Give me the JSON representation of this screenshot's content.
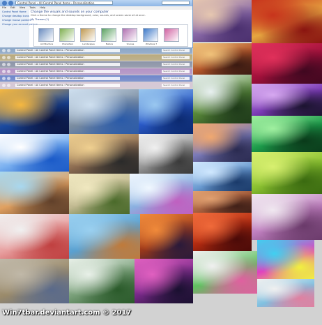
{
  "window": {
    "address": "Control Panel  ›  All Control Panel Items  ›  Personalization",
    "menu": [
      "File",
      "Edit",
      "View",
      "Tools",
      "Help"
    ],
    "left_pane": [
      "Control Panel Home",
      "Change desktop icons",
      "Change mouse pointers",
      "Change your account picture"
    ],
    "heading": "Change the visuals and sounds on your computer",
    "subtext": "Click a theme to change the desktop background, color, sounds, and screen saver all at once.",
    "section_label": "My Themes (1)",
    "themes": [
      {
        "label": "Architecture",
        "color": "#6a8cc0"
      },
      {
        "label": "Characters",
        "color": "#7fb050"
      },
      {
        "label": "Landscapes",
        "color": "#c09850"
      },
      {
        "label": "Nature",
        "color": "#5aa060"
      },
      {
        "label": "Scenes",
        "color": "#b070b0"
      },
      {
        "label": "Windows 7",
        "color": "#3c78c8"
      },
      {
        "label": "",
        "color": "#d060a0"
      }
    ]
  },
  "title_bars": [
    {
      "address": "Control Panel  ›  All Control Panel Items  ›  Personalization",
      "search": "Search Control Panel",
      "color": "#8aa6c8"
    },
    {
      "address": "Control Panel  ›  All Control Panel Items  ›  Personalization",
      "search": "Search Control Panel",
      "color": "#b9aa7d"
    },
    {
      "address": "Control Panel  ›  All Control Panel Items  ›  Personalization",
      "search": "Search Control Panel",
      "color": "#8c94a8"
    },
    {
      "address": "Control Panel  ›  All Control Panel Items  ›  Personalization",
      "search": "Search Control Panel",
      "color": "#b492c6"
    },
    {
      "address": "Control Panel  ›  All Control Panel Items  ›  Personalization",
      "search": "Search Control Panel",
      "color": "#6e86cc"
    },
    {
      "address": "Control Panel  ›  All Control Panel Items  ›  Personalization",
      "search": "Search Control Panel",
      "color": "#d7c8d6"
    }
  ],
  "wallpapers": [
    {
      "name": "lavender-field-image",
      "colors": [
        "#e6c7b0",
        "#8a6aa8",
        "#4a2f6e"
      ]
    },
    {
      "name": "autumn-leaves-image",
      "colors": [
        "#c8341c",
        "#e6a640",
        "#8a1410"
      ]
    },
    {
      "name": "red-rock-arch-image",
      "colors": [
        "#f0c27a",
        "#b2552a",
        "#3a1a12"
      ]
    },
    {
      "name": "red-dahlia-image",
      "colors": [
        "#e0305a",
        "#a0103a",
        "#400820"
      ]
    },
    {
      "name": "waterfall-image",
      "colors": [
        "#e8f0f0",
        "#5a8a3a",
        "#1e3a1a"
      ]
    },
    {
      "name": "purple-thistle-image",
      "colors": [
        "#d6a8f0",
        "#7a3ab4",
        "#1c1430"
      ]
    },
    {
      "name": "bridge-arches-image",
      "colors": [
        "#f6b840",
        "#1a4aa0",
        "#0a1440"
      ]
    },
    {
      "name": "perforated-dome-image",
      "colors": [
        "#cfe0f0",
        "#7a8ca0",
        "#2a5aa8"
      ]
    },
    {
      "name": "blue-curved-building-image",
      "colors": [
        "#9ac8f0",
        "#2a5ac8",
        "#0c2a70"
      ]
    },
    {
      "name": "coastal-rocks-image",
      "colors": [
        "#f0a870",
        "#7a7ab8",
        "#2a2a50"
      ]
    },
    {
      "name": "green-leaves-image",
      "colors": [
        "#a0f0a0",
        "#1c9a4a",
        "#0a3a1a"
      ]
    },
    {
      "name": "white-museum-image",
      "colors": [
        "#ffffff",
        "#7ab0f0",
        "#1a5ac8"
      ]
    },
    {
      "name": "curved-metal-image",
      "colors": [
        "#f0d090",
        "#8a6a50",
        "#2a2a2a"
      ]
    },
    {
      "name": "white-figures-image",
      "colors": [
        "#f0f0f0",
        "#9a9a9a",
        "#3a3a3a"
      ]
    },
    {
      "name": "mountain-lake-image",
      "colors": [
        "#d0e8ff",
        "#6a9ad0",
        "#1a3a6a"
      ]
    },
    {
      "name": "green-succulent-image",
      "colors": [
        "#d8f070",
        "#8ac030",
        "#3a6a10"
      ]
    },
    {
      "name": "fish-town-illustration",
      "colors": [
        "#a8d8f0",
        "#e0a060",
        "#60402a"
      ]
    },
    {
      "name": "beetles-illustration",
      "colors": [
        "#f0e8c0",
        "#c0b890",
        "#4a6a2a"
      ]
    },
    {
      "name": "creature-illustration",
      "colors": [
        "#f0f8ff",
        "#8ab0e0",
        "#c060c0"
      ]
    },
    {
      "name": "sand-dunes-image",
      "colors": [
        "#e0a070",
        "#a05a3a",
        "#402018"
      ]
    },
    {
      "name": "spiky-flower-image",
      "colors": [
        "#f0e8f0",
        "#c080c0",
        "#6a3a6a"
      ]
    },
    {
      "name": "carnival-illustration",
      "colors": [
        "#f0f0f0",
        "#e8a0a0",
        "#c04040"
      ]
    },
    {
      "name": "floating-island-illustration",
      "colors": [
        "#9ad0f0",
        "#5aa0d0",
        "#c07a3a"
      ]
    },
    {
      "name": "space-needle-image",
      "colors": [
        "#f08a3a",
        "#a03a1a",
        "#2a1a3a"
      ]
    },
    {
      "name": "red-canyon-image",
      "colors": [
        "#f06a3a",
        "#b02a10",
        "#4a0a08"
      ]
    },
    {
      "name": "abstract-colors-illustration",
      "colors": [
        "#c0b8a8",
        "#9a8a6a",
        "#5a6a8a"
      ]
    },
    {
      "name": "green-garden-illustration",
      "colors": [
        "#e8f0e8",
        "#7aa07a",
        "#2a5a2a"
      ]
    },
    {
      "name": "bubbles-illustration",
      "colors": [
        "#e060c0",
        "#7a2a8a",
        "#1a1030"
      ]
    },
    {
      "name": "rainbow-ribbons-illustration",
      "colors": [
        "#f0f0f0",
        "#60c060",
        "#e060a0"
      ]
    },
    {
      "name": "colorful-splash-illustration",
      "colors": [
        "#40d0f0",
        "#e040c0",
        "#f0f040"
      ]
    },
    {
      "name": "sketch-scene-illustration",
      "colors": [
        "#f0f0f0",
        "#80c0e0",
        "#e080a0"
      ]
    }
  ],
  "credit": "Win7tbar.deviantart.com  © 2017"
}
